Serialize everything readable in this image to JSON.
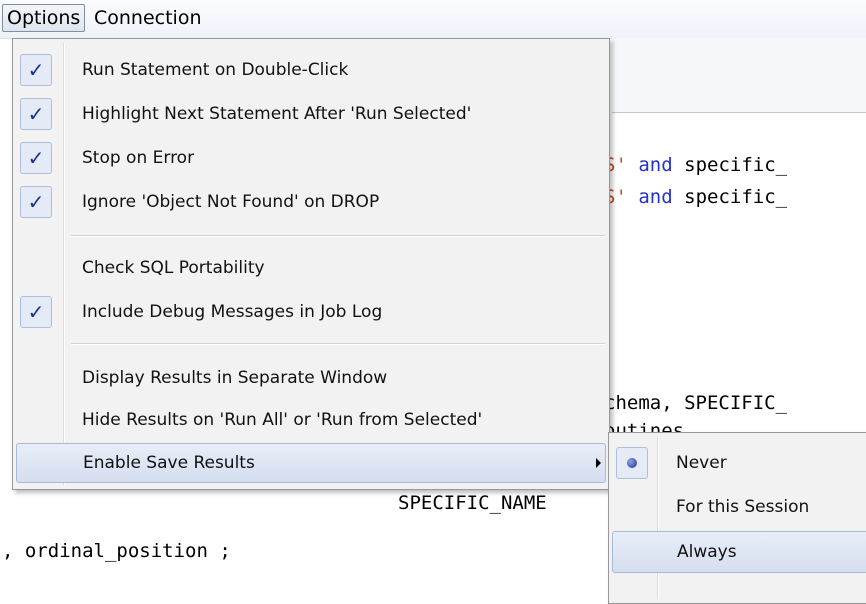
{
  "menubar": {
    "items": [
      "Options",
      "Connection"
    ]
  },
  "editor": {
    "line1": {
      "str": "S'",
      "kw": "and",
      "rest": "specific_"
    },
    "line2": {
      "str": "S'",
      "kw": "and",
      "rest": "specific_"
    },
    "line3": "chema, SPECIFIC_",
    "line4": "outines",
    "line5": "SPECIFIC_NAME",
    "line6": ", ordinal_position ;"
  },
  "options_menu": {
    "items": [
      {
        "label": "Run Statement on Double-Click",
        "checked": true
      },
      {
        "label": "Highlight Next Statement After 'Run Selected'",
        "checked": true
      },
      {
        "label": "Stop on Error",
        "checked": true
      },
      {
        "label": "Ignore 'Object Not Found' on DROP",
        "checked": true
      },
      {
        "label": "Check SQL Portability",
        "checked": false
      },
      {
        "label": "Include Debug Messages in Job Log",
        "checked": true
      },
      {
        "label": "Display Results in Separate Window",
        "checked": false
      },
      {
        "label": "Hide Results on 'Run All' or 'Run from Selected'",
        "checked": false
      },
      {
        "label": "Enable Save Results",
        "checked": false
      }
    ],
    "check_glyph": "✓"
  },
  "save_results_submenu": {
    "items": [
      {
        "label": "Never",
        "selected": true
      },
      {
        "label": "For this Session",
        "selected": false
      },
      {
        "label": "Always",
        "selected": false
      }
    ]
  }
}
